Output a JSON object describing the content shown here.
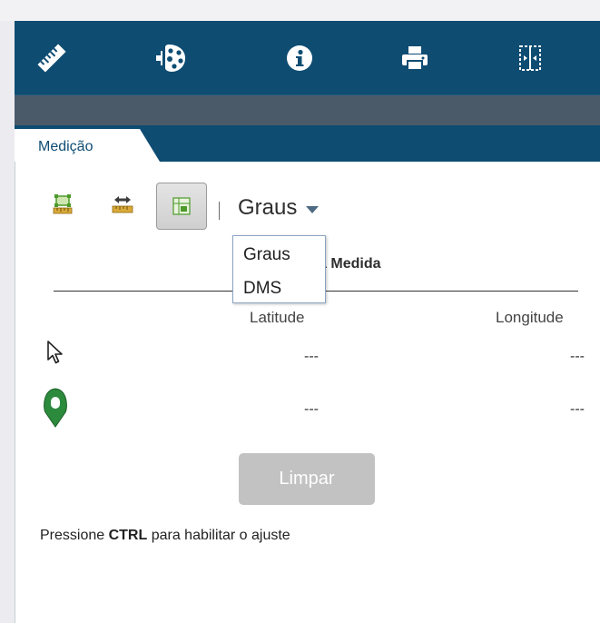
{
  "toolbar": {
    "icons": [
      "ruler-icon",
      "paint-palette-icon",
      "info-icon",
      "print-icon",
      "split-view-icon"
    ]
  },
  "tab": {
    "label": "Medição"
  },
  "measure": {
    "tools": [
      "area-measure-icon",
      "distance-measure-icon",
      "location-measure-icon"
    ],
    "active_tool": "location-measure-icon",
    "unit_selected": "Graus",
    "unit_options": [
      "Graus",
      "DMS"
    ]
  },
  "result": {
    "title": "Resultado da Medida",
    "col_latitude": "Latitude",
    "col_longitude": "Longitude",
    "rows": [
      {
        "icon": "mouse-pointer-icon",
        "lat": "---",
        "lon": "---"
      },
      {
        "icon": "map-pin-icon",
        "lat": "---",
        "lon": "---"
      }
    ]
  },
  "clear_button": "Limpar",
  "hint": {
    "prefix": "Pressione ",
    "key": "CTRL",
    "suffix": " para habilitar o ajuste"
  },
  "colors": {
    "toolbar_bg": "#0e4c72",
    "band": "#4a5a69",
    "pin": "#2c8a3c",
    "disabled_button": "#c2c2c2"
  }
}
